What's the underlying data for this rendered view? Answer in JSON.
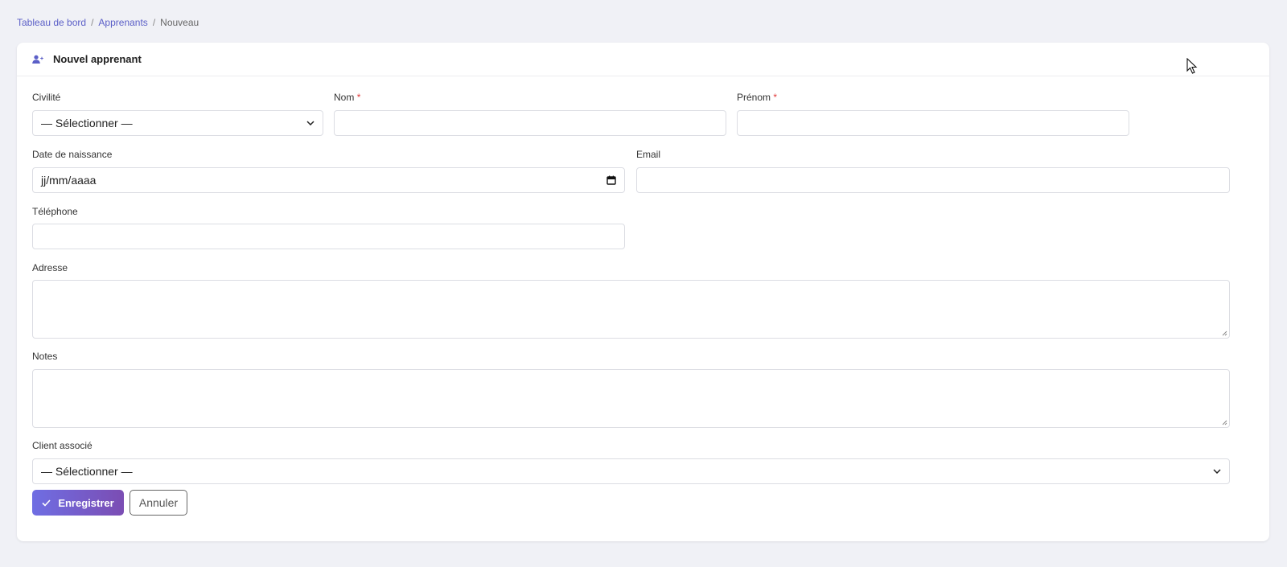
{
  "breadcrumb": {
    "items": [
      "Tableau de bord",
      "Apprenants"
    ],
    "separator": "/",
    "current": "Nouveau"
  },
  "card": {
    "title": "Nouvel apprenant",
    "icon": "user-plus-icon"
  },
  "form": {
    "civilite": {
      "label": "Civilité",
      "value": "— Sélectionner —"
    },
    "nom": {
      "label": "Nom",
      "required": "*",
      "value": ""
    },
    "prenom": {
      "label": "Prénom",
      "required": "*",
      "value": ""
    },
    "date_naissance": {
      "label": "Date de naissance",
      "value": "jj/mm/aaaa"
    },
    "email": {
      "label": "Email",
      "value": ""
    },
    "telephone": {
      "label": "Téléphone",
      "value": ""
    },
    "adresse": {
      "label": "Adresse",
      "value": ""
    },
    "notes": {
      "label": "Notes",
      "value": ""
    },
    "client": {
      "label": "Client associé",
      "value": "— Sélectionner —"
    }
  },
  "actions": {
    "save_label": "Enregistrer",
    "cancel_label": "Annuler"
  },
  "colors": {
    "accent": "#6f6ee3",
    "accent_end": "#7b4db3",
    "required": "#e03a3a",
    "link": "#5b5fc7"
  }
}
